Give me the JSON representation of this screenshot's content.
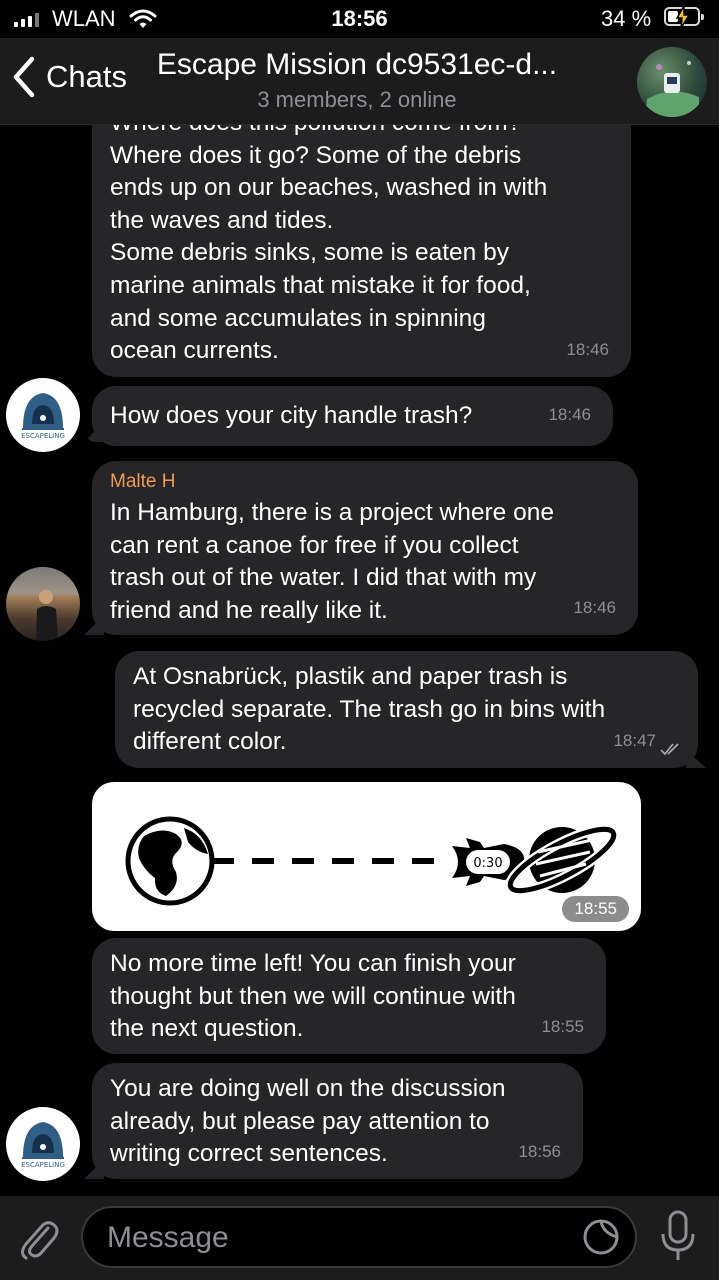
{
  "status_bar": {
    "carrier": "WLAN",
    "time": "18:56",
    "battery": "34 %"
  },
  "header": {
    "back_label": "Chats",
    "title": "Escape Mission dc9531ec-d...",
    "subtitle": "3 members, 2 online"
  },
  "messages": [
    {
      "text": "Where does this pollution come from?\nWhere does it go? Some of the debris\nends up on our beaches, washed in with\nthe waves and tides.\nSome debris sinks, some is eaten by\nmarine animals that mistake it for food,\nand some accumulates in spinning\nocean currents.",
      "time": "18:46"
    },
    {
      "text": "How does your city handle trash?",
      "time": "18:46"
    },
    {
      "sender": "Malte H",
      "text": "In Hamburg, there is a project where one\ncan rent a canoe for free if you collect\ntrash out of the water. I did that with my\nfriend and he really like it.",
      "time": "18:46"
    },
    {
      "text": "At Osnabrück, plastik and paper trash is\nrecycled separate. The trash go in bins with\ndifferent color.",
      "time": "18:47"
    },
    {
      "timer": "0:30",
      "time": "18:55"
    },
    {
      "text": "No more time left! You can finish your\nthought but then we will continue with\nthe next question.",
      "time": "18:55"
    },
    {
      "text": "You are doing well on the discussion\nalready, but please pay attention to\nwriting correct sentences.",
      "time": "18:56"
    }
  ],
  "avatar_badge": "ESCAPELING",
  "input": {
    "placeholder": "Message"
  },
  "colors": {
    "background": "#000000",
    "bubble": "#262628",
    "sender_name": "#f19a4f",
    "meta": "#8e8e93"
  }
}
